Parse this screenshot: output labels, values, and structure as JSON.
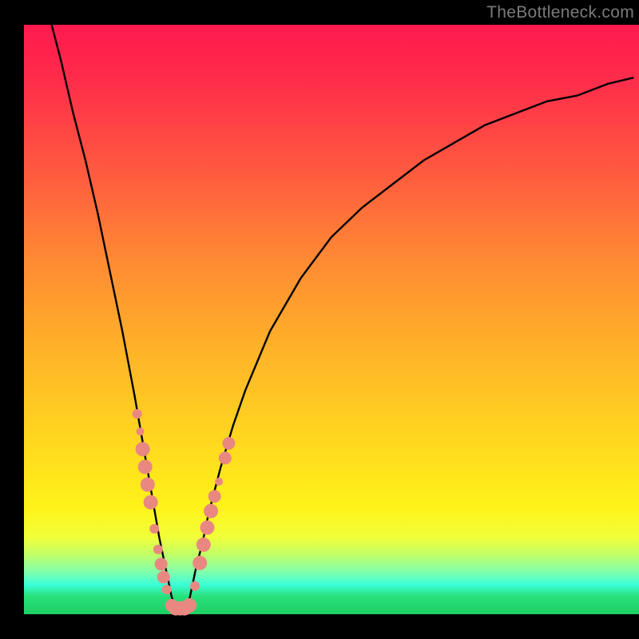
{
  "attribution": "TheBottleneck.com",
  "colors": {
    "frame": "#000000",
    "curve": "#000000",
    "marker_fill": "#e98880",
    "gradient_top": "#ff1a4f",
    "gradient_bottom": "#20c962"
  },
  "chart_data": {
    "type": "line",
    "title": "",
    "xlabel": "",
    "ylabel": "",
    "xlim": [
      0,
      100
    ],
    "ylim": [
      0,
      100
    ],
    "description": "Bottleneck percentage curve: a V-shaped black curve on a vertical red-to-green gradient. Minimum (0% bottleneck) occurs near x≈25 (green zone). Salmon markers highlight a cluster of sample points near the bottom of the V.",
    "series": [
      {
        "name": "bottleneck_curve",
        "x": [
          4.5,
          6,
          8,
          10,
          12,
          14,
          16,
          18,
          19,
          20,
          21,
          22,
          23,
          24,
          25,
          26,
          27,
          28,
          29,
          30,
          31,
          32,
          34,
          36,
          40,
          45,
          50,
          55,
          60,
          65,
          70,
          75,
          80,
          85,
          90,
          95,
          99
        ],
        "y": [
          100,
          94,
          85,
          77,
          68,
          58,
          48,
          37,
          31,
          25,
          19,
          13,
          8,
          3,
          0,
          0,
          3,
          8,
          12,
          17,
          21,
          25,
          32,
          38,
          48,
          57,
          64,
          69,
          73,
          77,
          80,
          83,
          85,
          87,
          88,
          90,
          91
        ]
      }
    ],
    "markers": [
      {
        "x": 18.4,
        "y": 34,
        "r": 6
      },
      {
        "x": 18.9,
        "y": 31,
        "r": 5
      },
      {
        "x": 19.3,
        "y": 28,
        "r": 9
      },
      {
        "x": 19.7,
        "y": 25,
        "r": 9
      },
      {
        "x": 20.1,
        "y": 22,
        "r": 9
      },
      {
        "x": 20.6,
        "y": 19,
        "r": 9
      },
      {
        "x": 21.2,
        "y": 14.5,
        "r": 6
      },
      {
        "x": 21.8,
        "y": 11,
        "r": 6
      },
      {
        "x": 22.3,
        "y": 8.5,
        "r": 8
      },
      {
        "x": 22.7,
        "y": 6.3,
        "r": 8
      },
      {
        "x": 23.2,
        "y": 4.2,
        "r": 6
      },
      {
        "x": 24.0,
        "y": 1.5,
        "r": 8
      },
      {
        "x": 24.7,
        "y": 1.0,
        "r": 9
      },
      {
        "x": 25.4,
        "y": 1.0,
        "r": 9
      },
      {
        "x": 26.1,
        "y": 1.0,
        "r": 9
      },
      {
        "x": 26.9,
        "y": 1.5,
        "r": 9
      },
      {
        "x": 27.8,
        "y": 4.8,
        "r": 6
      },
      {
        "x": 28.6,
        "y": 8.7,
        "r": 9
      },
      {
        "x": 29.2,
        "y": 11.8,
        "r": 9
      },
      {
        "x": 29.8,
        "y": 14.7,
        "r": 9
      },
      {
        "x": 30.4,
        "y": 17.5,
        "r": 9
      },
      {
        "x": 31.0,
        "y": 20,
        "r": 8
      },
      {
        "x": 31.7,
        "y": 22.5,
        "r": 5
      },
      {
        "x": 32.7,
        "y": 26.5,
        "r": 8
      },
      {
        "x": 33.3,
        "y": 29.0,
        "r": 8
      }
    ]
  }
}
